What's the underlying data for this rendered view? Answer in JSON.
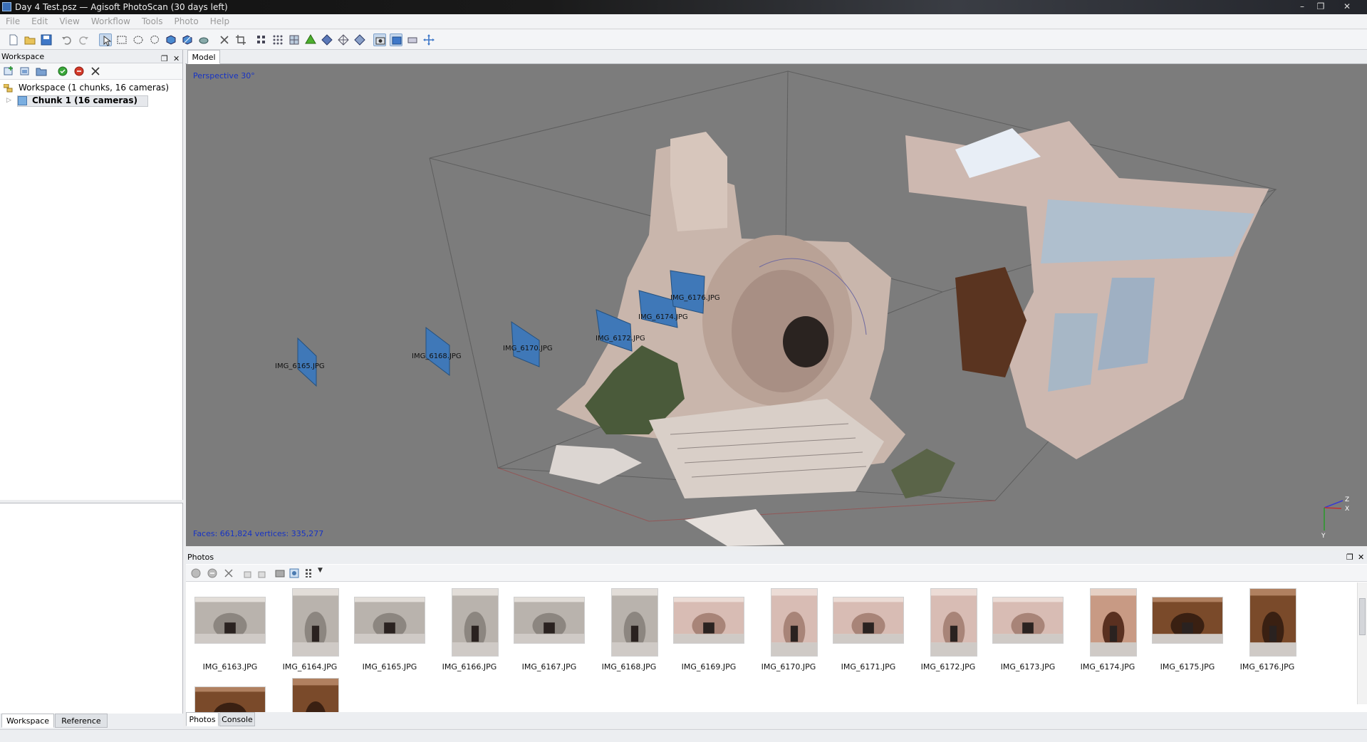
{
  "window": {
    "title": "Day 4 Test.psz — Agisoft PhotoScan (30 days left)"
  },
  "menu": [
    "File",
    "Edit",
    "View",
    "Workflow",
    "Tools",
    "Photo",
    "Help"
  ],
  "workspace": {
    "title": "Workspace",
    "root_label": "Workspace (1 chunks, 16 cameras)",
    "chunk_label": "Chunk 1 (16 cameras)"
  },
  "left_tabs": {
    "workspace": "Workspace",
    "reference": "Reference"
  },
  "model": {
    "tab_label": "Model",
    "perspective_label": "Perspective 30°",
    "stats_label": "Faces: 661,824 vertices: 335,277",
    "axis": {
      "z": "Z",
      "x": "X",
      "y": "Y"
    },
    "cameras": [
      "IMG_6165.JPG",
      "IMG_6168.JPG",
      "IMG_6170.JPG",
      "IMG_6172.JPG",
      "IMG_6174.JPG",
      "IMG_6176.JPG"
    ]
  },
  "photos": {
    "title": "Photos",
    "items": [
      {
        "label": "IMG_6163.JPG",
        "orientation": "landscape",
        "tone": "stone"
      },
      {
        "label": "IMG_6164.JPG",
        "orientation": "portrait",
        "tone": "stone"
      },
      {
        "label": "IMG_6165.JPG",
        "orientation": "landscape",
        "tone": "stone"
      },
      {
        "label": "IMG_6166.JPG",
        "orientation": "portrait",
        "tone": "stone"
      },
      {
        "label": "IMG_6167.JPG",
        "orientation": "landscape",
        "tone": "stone"
      },
      {
        "label": "IMG_6168.JPG",
        "orientation": "portrait",
        "tone": "stone"
      },
      {
        "label": "IMG_6169.JPG",
        "orientation": "landscape",
        "tone": "pink"
      },
      {
        "label": "IMG_6170.JPG",
        "orientation": "portrait",
        "tone": "pink"
      },
      {
        "label": "IMG_6171.JPG",
        "orientation": "landscape",
        "tone": "pink"
      },
      {
        "label": "IMG_6172.JPG",
        "orientation": "portrait",
        "tone": "pink"
      },
      {
        "label": "IMG_6173.JPG",
        "orientation": "landscape",
        "tone": "pink"
      },
      {
        "label": "IMG_6174.JPG",
        "orientation": "portrait",
        "tone": "warm"
      },
      {
        "label": "IMG_6175.JPG",
        "orientation": "landscape",
        "tone": "brown"
      },
      {
        "label": "IMG_6176.JPG",
        "orientation": "portrait",
        "tone": "brown"
      },
      {
        "label": "",
        "orientation": "landscape",
        "tone": "brown"
      },
      {
        "label": "",
        "orientation": "portrait",
        "tone": "brown"
      }
    ]
  },
  "bottom_tabs": {
    "photos": "Photos",
    "console": "Console"
  },
  "colors": {
    "accent_blue": "#1733c4",
    "camera_plane": "#3f78b8",
    "viewport_bg": "#7c7c7c"
  }
}
